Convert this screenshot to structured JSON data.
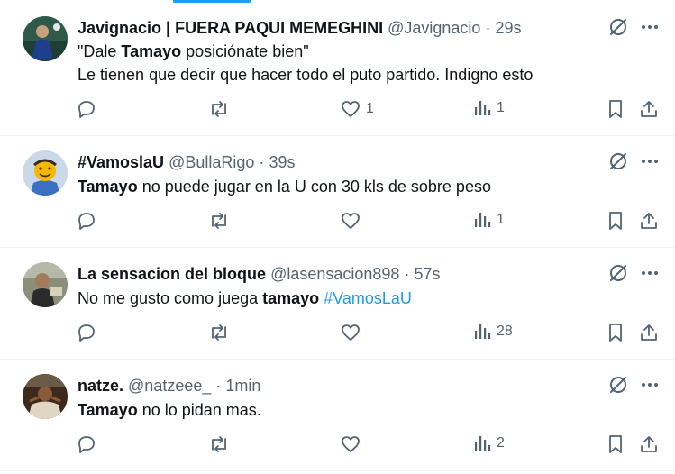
{
  "tweets": [
    {
      "name": "Javignacio | FUERA PAQUI MEMEGHINI",
      "handle": "@Javignacio",
      "time": "29s",
      "lines": [
        {
          "pre": "\"Dale ",
          "bold": "Tamayo",
          "post": " posiciónate bien\"",
          "hashtag": ""
        },
        {
          "pre": "Le tienen que decir que hacer todo el puto partido. Indigno esto",
          "bold": "",
          "post": "",
          "hashtag": ""
        }
      ],
      "replies": "",
      "retweets": "",
      "likes": "1",
      "views": "1"
    },
    {
      "name": "#VamoslaU",
      "handle": "@BullaRigo",
      "time": "39s",
      "lines": [
        {
          "pre": "",
          "bold": "Tamayo",
          "post": " no puede jugar en la U con 30 kls de sobre peso",
          "hashtag": ""
        }
      ],
      "replies": "",
      "retweets": "",
      "likes": "",
      "views": "1"
    },
    {
      "name": "La sensacion del bloque",
      "handle": "@lasensacion898",
      "time": "57s",
      "lines": [
        {
          "pre": "No me gusto como juega ",
          "bold": "tamayo",
          "post": " ",
          "hashtag": "#VamosLaU"
        }
      ],
      "replies": "",
      "retweets": "",
      "likes": "",
      "views": "28"
    },
    {
      "name": "natze.",
      "handle": "@natzeee_",
      "time": "1min",
      "lines": [
        {
          "pre": "",
          "bold": "Tamayo",
          "post": " no lo pidan mas.",
          "hashtag": ""
        }
      ],
      "replies": "",
      "retweets": "",
      "likes": "",
      "views": "2"
    }
  ],
  "separator": "·",
  "colors": {
    "accent": "#1d9bf0",
    "text": "#0f1419",
    "muted": "#536471",
    "border": "#eff3f4"
  },
  "icons": [
    "grok-icon",
    "more-icon",
    "reply-icon",
    "retweet-icon",
    "like-icon",
    "views-icon",
    "bookmark-icon",
    "share-icon"
  ]
}
